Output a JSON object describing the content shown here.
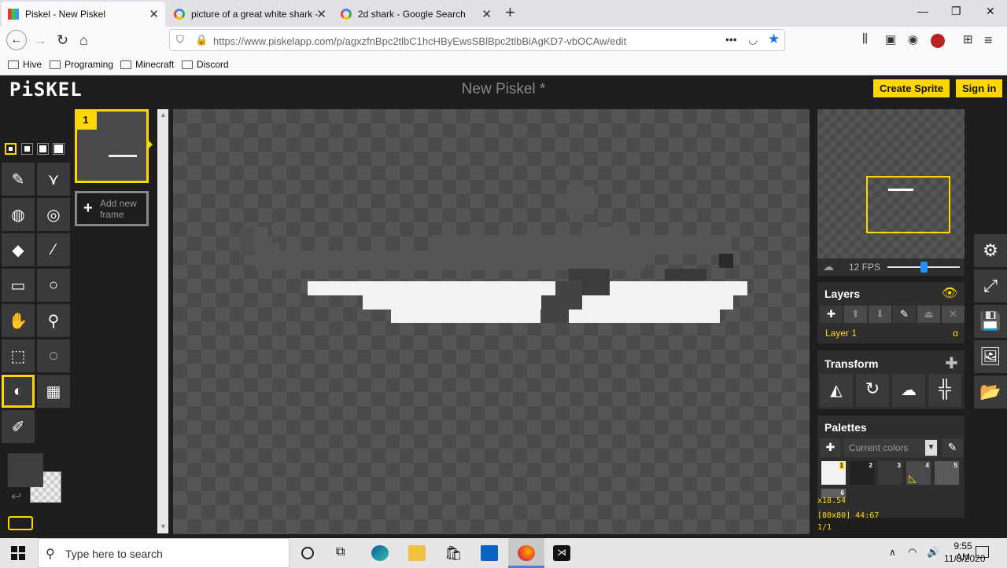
{
  "browser": {
    "tabs": [
      {
        "title": "Piskel - New Piskel",
        "active": true
      },
      {
        "title": "picture of a great white shark -",
        "active": false
      },
      {
        "title": "2d shark - Google Search",
        "active": false
      }
    ],
    "new_tab": "+",
    "url": "https://www.piskelapp.com/p/agxzfnBpc2tlbC1hcHByEwsSBlBpc2tlbBiAgKD7-vbOCAw/edit",
    "bookmarks": [
      "Hive",
      "Programing",
      "Minecraft",
      "Discord"
    ]
  },
  "app": {
    "logo": "PiSKEL",
    "title": "New Piskel *",
    "create_sprite": "Create Sprite",
    "sign_in": "Sign in"
  },
  "frames": {
    "frame_number": "1",
    "add_new_frame": "Add new frame"
  },
  "preview": {
    "fps": "12 FPS",
    "fps_value": 12
  },
  "layers": {
    "title": "Layers",
    "layer_name": "Layer 1",
    "alpha": "α"
  },
  "transform": {
    "title": "Transform"
  },
  "palettes": {
    "title": "Palettes",
    "selected": "Current colors",
    "swatches": [
      {
        "num": "1",
        "color": "#f2f2f2"
      },
      {
        "num": "2",
        "color": "#222222"
      },
      {
        "num": "3",
        "color": "#3a3a3a"
      },
      {
        "num": "4",
        "color": "#4a4a4a"
      },
      {
        "num": "5",
        "color": "#5a5a5a"
      },
      {
        "num": "6",
        "color": "#606060"
      }
    ]
  },
  "status": {
    "zoom": "x18.54",
    "size_cursor": "[80x80] 44:67",
    "frame_index": "1/1"
  },
  "colors": {
    "primary": "#3f3f3f",
    "accent": "#ffd700"
  },
  "taskbar": {
    "search_placeholder": "Type here to search",
    "time": "9:55 AM",
    "date": "11/3/2020"
  }
}
